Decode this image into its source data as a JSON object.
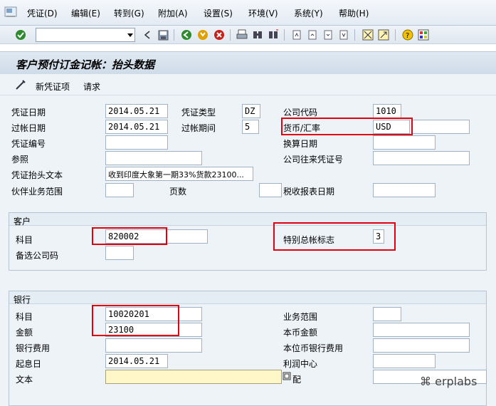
{
  "menu": {
    "items": [
      "凭证(D)",
      "编辑(E)",
      "转到(G)",
      "附加(A)",
      "设置(S)",
      "环境(V)",
      "系统(Y)",
      "帮助(H)"
    ]
  },
  "toolbar": {
    "command_field_value": ""
  },
  "title": "客户预付订金记帐：抬头数据",
  "app_toolbar": {
    "new_document": "新凭证项",
    "request": "请求"
  },
  "watermark": "erplabs",
  "header": {
    "doc_date_label": "凭证日期",
    "doc_date": "2014.05.21",
    "doc_type_label": "凭证类型",
    "doc_type": "DZ",
    "company_code_label": "公司代码",
    "company_code": "1010",
    "posting_date_label": "过帐日期",
    "posting_date": "2014.05.21",
    "period_label": "过帐期间",
    "period": "5",
    "currency_label": "货币/汇率",
    "currency": "USD",
    "exchange_rate": "",
    "doc_number_label": "凭证编号",
    "doc_number": "",
    "translation_date_label": "换算日期",
    "translation_date": "",
    "reference_label": "参照",
    "reference": "",
    "intercompany_label": "公司往来凭证号",
    "intercompany": "",
    "header_text_label": "凭证抬头文本",
    "header_text": "收到印度大象第一期33%货款23100...",
    "partner_ba_label": "伙伴业务范围",
    "partner_ba": "",
    "pages_label": "页数",
    "pages": "",
    "tax_date_label": "税收报表日期",
    "tax_date": ""
  },
  "customer": {
    "section_title": "客户",
    "account_label": "科目",
    "account": "820002",
    "special_gl_label": "特别总帐标志",
    "special_gl": "3",
    "alt_company_label": "备选公司码",
    "alt_company": ""
  },
  "bank": {
    "section_title": "银行",
    "account_label": "科目",
    "account": "10020201",
    "business_area_label": "业务范围",
    "business_area": "",
    "amount_label": "金额",
    "amount": "23100",
    "local_amount_label": "本币金额",
    "local_amount": "",
    "bank_charges_label": "银行费用",
    "bank_charges": "",
    "local_bank_charges_label": "本位币银行费用",
    "local_bank_charges": "",
    "value_date_label": "起息日",
    "value_date": "2014.05.21",
    "profit_center_label": "利润中心",
    "profit_center": "",
    "text_label": "文本",
    "text": "",
    "assignment_label": "配"
  },
  "footer_watermark": "erplabs",
  "colors": {
    "highlight_red": "#e00010",
    "watermark": "#e8614a",
    "panel": "#eef3f8"
  }
}
